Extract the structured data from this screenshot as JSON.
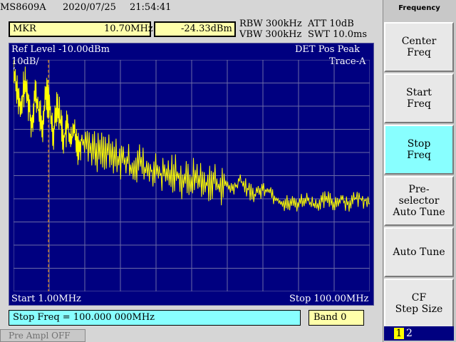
{
  "header": {
    "model": "MS8609A",
    "date": "2020/07/25",
    "time": "21:54:41"
  },
  "marker": {
    "label": "MKR",
    "freq": "10.70MHz",
    "amp": "-24.33dBm"
  },
  "settings": {
    "rbw": "RBW 300kHz",
    "vbw": "VBW 300kHz",
    "att": "ATT 10dB",
    "swt": "SWT 10.0ms"
  },
  "screen": {
    "ref_level": "Ref Level -10.00dBm",
    "scale": "10dB/",
    "detector": "DET  Pos Peak",
    "trace": "Trace-A",
    "start": "Start 1.00MHz",
    "stop": "Stop 100.00MHz"
  },
  "entry": {
    "text": "Stop Freq = 100.000 000MHz",
    "band": "Band 0"
  },
  "status": {
    "preamp": "Pre Ampl OFF"
  },
  "menu": {
    "title": "Frequency",
    "keys": [
      {
        "label": "Center\nFreq",
        "active": false
      },
      {
        "label": "Start\nFreq",
        "active": false
      },
      {
        "label": "Stop\nFreq",
        "active": true
      },
      {
        "label": "Pre-\nselector\nAuto Tune",
        "active": false
      },
      {
        "label": "Auto Tune",
        "active": false
      },
      {
        "label": "CF\nStep Size",
        "active": false
      }
    ],
    "page_current": "1",
    "page_other": "2"
  },
  "colors": {
    "screen_bg": "#000080",
    "trace": "#ffff00",
    "grid": "#6a6aa6",
    "active_key": "#88ffff",
    "field": "#ffffaa"
  },
  "chart_data": {
    "type": "line",
    "x_unit": "MHz",
    "y_unit": "dBm",
    "xlim": [
      1.0,
      100.0
    ],
    "ylim": [
      -110.0,
      -10.0
    ],
    "grid": true,
    "x": [
      1,
      2,
      3,
      4,
      5,
      6,
      7,
      8,
      9,
      10,
      11,
      12,
      13,
      14,
      15,
      16,
      17,
      18,
      19,
      20,
      22,
      24,
      26,
      28,
      30,
      32,
      34,
      36,
      38,
      40,
      42,
      44,
      46,
      48,
      50,
      52,
      54,
      56,
      58,
      60,
      62,
      64,
      66,
      68,
      70,
      72,
      74,
      76,
      78,
      80,
      82,
      84,
      86,
      88,
      90,
      92,
      94,
      96,
      98,
      100
    ],
    "y": [
      -14,
      -22,
      -34,
      -20,
      -26,
      -38,
      -24,
      -32,
      -40,
      -24,
      -30,
      -42,
      -28,
      -36,
      -44,
      -38,
      -46,
      -40,
      -48,
      -44,
      -46,
      -50,
      -48,
      -52,
      -52,
      -54,
      -56,
      -54,
      -58,
      -58,
      -60,
      -60,
      -58,
      -62,
      -62,
      -60,
      -64,
      -62,
      -64,
      -64,
      -66,
      -62,
      -66,
      -68,
      -66,
      -66,
      -70,
      -72,
      -72,
      -72,
      -70,
      -72,
      -72,
      -70,
      -72,
      -70,
      -72,
      -70,
      -70,
      -72
    ],
    "markers": [
      {
        "freq_mhz": 10.7,
        "amp_dbm": -24.33
      }
    ]
  }
}
